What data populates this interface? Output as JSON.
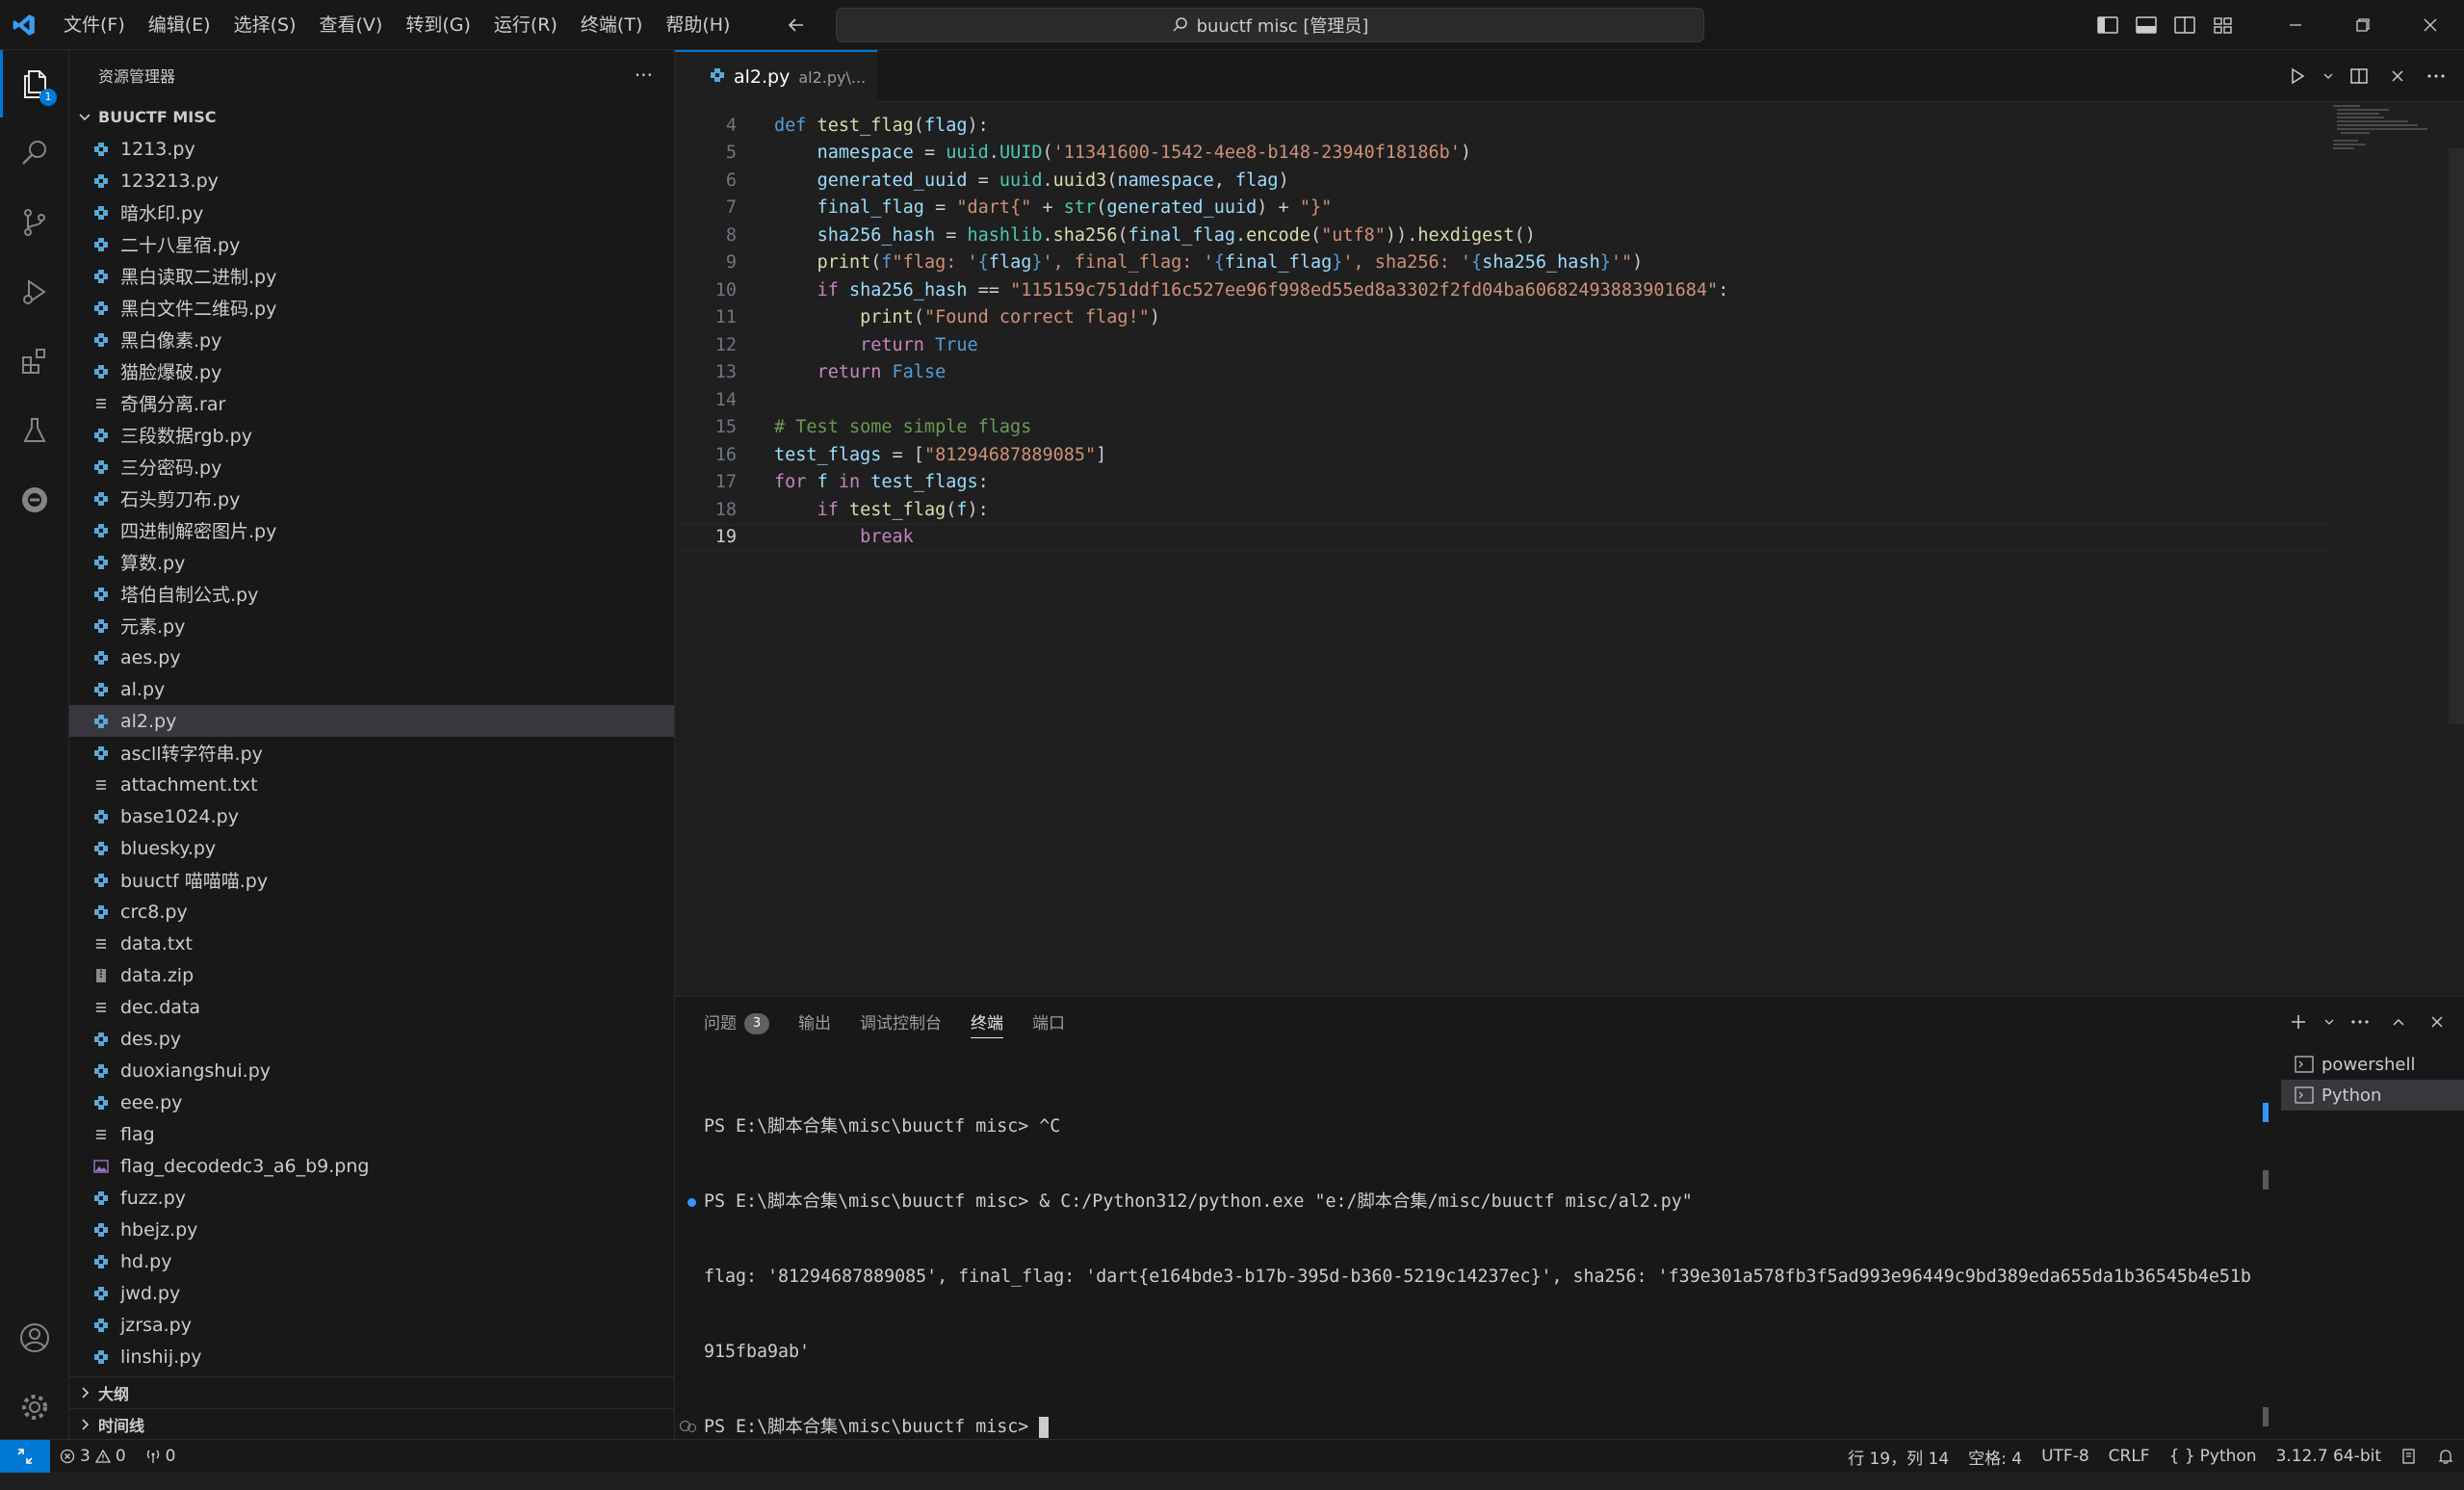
{
  "titlebar": {
    "menu": [
      "文件(F)",
      "编辑(E)",
      "选择(S)",
      "查看(V)",
      "转到(G)",
      "运行(R)",
      "终端(T)",
      "帮助(H)"
    ],
    "search_text": "buuctf misc [管理员]"
  },
  "activity": {
    "explorer_badge": "1"
  },
  "sidebar": {
    "title": "资源管理器",
    "more": "···",
    "folder": "BUUCTF MISC",
    "files": [
      {
        "name": "1213.py",
        "type": "py"
      },
      {
        "name": "123213.py",
        "type": "py"
      },
      {
        "name": "暗水印.py",
        "type": "py"
      },
      {
        "name": "二十八星宿.py",
        "type": "py"
      },
      {
        "name": "黑白读取二进制.py",
        "type": "py"
      },
      {
        "name": "黑白文件二维码.py",
        "type": "py"
      },
      {
        "name": "黑白像素.py",
        "type": "py"
      },
      {
        "name": "猫脸爆破.py",
        "type": "py"
      },
      {
        "name": "奇偶分离.rar",
        "type": "txt"
      },
      {
        "name": "三段数据rgb.py",
        "type": "py"
      },
      {
        "name": "三分密码.py",
        "type": "py"
      },
      {
        "name": "石头剪刀布.py",
        "type": "py"
      },
      {
        "name": "四进制解密图片.py",
        "type": "py"
      },
      {
        "name": "算数.py",
        "type": "py"
      },
      {
        "name": "塔伯自制公式.py",
        "type": "py"
      },
      {
        "name": "元素.py",
        "type": "py"
      },
      {
        "name": "aes.py",
        "type": "py"
      },
      {
        "name": "al.py",
        "type": "py"
      },
      {
        "name": "al2.py",
        "type": "py"
      },
      {
        "name": "ascll转字符串.py",
        "type": "py"
      },
      {
        "name": "attachment.txt",
        "type": "txt"
      },
      {
        "name": "base1024.py",
        "type": "py"
      },
      {
        "name": "bluesky.py",
        "type": "py"
      },
      {
        "name": "buuctf 喵喵喵.py",
        "type": "py"
      },
      {
        "name": "crc8.py",
        "type": "py"
      },
      {
        "name": "data.txt",
        "type": "txt"
      },
      {
        "name": "data.zip",
        "type": "zip"
      },
      {
        "name": "dec.data",
        "type": "txt"
      },
      {
        "name": "des.py",
        "type": "py"
      },
      {
        "name": "duoxiangshui.py",
        "type": "py"
      },
      {
        "name": "eee.py",
        "type": "py"
      },
      {
        "name": "flag",
        "type": "txt"
      },
      {
        "name": "flag_decodedc3_a6_b9.png",
        "type": "img"
      },
      {
        "name": "fuzz.py",
        "type": "py"
      },
      {
        "name": "hbejz.py",
        "type": "py"
      },
      {
        "name": "hd.py",
        "type": "py"
      },
      {
        "name": "jwd.py",
        "type": "py"
      },
      {
        "name": "jzrsa.py",
        "type": "py"
      },
      {
        "name": "linshij.py",
        "type": "py"
      }
    ],
    "selected_file": "al2.py",
    "outline": "大纲",
    "timeline": "时间线"
  },
  "editor": {
    "tab_name": "al2.py",
    "tab_path": "al2.py\\...",
    "line_numbers": [
      "4",
      "5",
      "6",
      "7",
      "8",
      "9",
      "10",
      "11",
      "12",
      "13",
      "14",
      "15",
      "16",
      "17",
      "18",
      "19"
    ],
    "current_line": "19"
  },
  "panel": {
    "tabs": [
      {
        "label": "问题",
        "count": "3"
      },
      {
        "label": "输出"
      },
      {
        "label": "调试控制台"
      },
      {
        "label": "终端"
      },
      {
        "label": "端口"
      }
    ],
    "active_tab": "终端",
    "terminal_lines": [
      "PS E:\\脚本合集\\misc\\buuctf misc> ^C",
      "PS E:\\脚本合集\\misc\\buuctf misc> & C:/Python312/python.exe \"e:/脚本合集/misc/buuctf misc/al2.py\"",
      "flag: '81294687889085', final_flag: 'dart{e164bde3-b17b-395d-b360-5219c14237ec}', sha256: 'f39e301a578fb3f5ad993e96449c9bd389eda655da1b36545b4e51b",
      "915fba9ab'",
      "PS E:\\脚本合集\\misc\\buuctf misc> "
    ],
    "terminals": [
      "powershell",
      "Python"
    ],
    "selected_terminal": "Python"
  },
  "statusbar": {
    "errors": "3",
    "warnings": "0",
    "ports": "0",
    "position": "行 19，列 14",
    "spaces": "空格: 4",
    "encoding": "UTF-8",
    "eol": "CRLF",
    "language": "Python",
    "interpreter": "3.12.7 64-bit"
  },
  "colors": {
    "accent": "#0078d4",
    "background": "#1f1f1f",
    "sidebar": "#181818"
  }
}
